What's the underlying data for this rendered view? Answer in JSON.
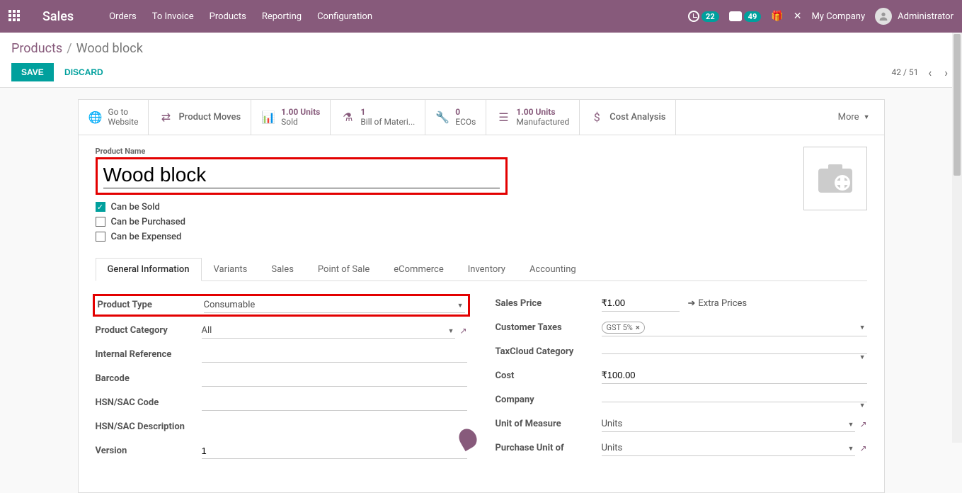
{
  "topbar": {
    "app_title": "Sales",
    "menu": [
      "Orders",
      "To Invoice",
      "Products",
      "Reporting",
      "Configuration"
    ],
    "activity_count": "22",
    "message_count": "49",
    "company": "My Company",
    "user": "Administrator"
  },
  "breadcrumb": {
    "parent": "Products",
    "current": "Wood block"
  },
  "actions": {
    "save": "SAVE",
    "discard": "DISCARD"
  },
  "pager": {
    "text": "42 / 51"
  },
  "stat_buttons": {
    "website": "Go to\nWebsite",
    "moves": "Product Moves",
    "sold_value": "1.00 Units",
    "sold_label": "Sold",
    "bom_value": "1",
    "bom_label": "Bill of Materi...",
    "eco_value": "0",
    "eco_label": "ECOs",
    "mfg_value": "1.00 Units",
    "mfg_label": "Manufactured",
    "cost": "Cost Analysis",
    "more": "More"
  },
  "product": {
    "name_label": "Product Name",
    "name": "Wood block",
    "can_be_sold_label": "Can be Sold",
    "can_be_purchased_label": "Can be Purchased",
    "can_be_expensed_label": "Can be Expensed"
  },
  "tabs": [
    "General Information",
    "Variants",
    "Sales",
    "Point of Sale",
    "eCommerce",
    "Inventory",
    "Accounting"
  ],
  "fields_left": {
    "product_type_label": "Product Type",
    "product_type_value": "Consumable",
    "category_label": "Product Category",
    "category_value": "All",
    "internal_ref_label": "Internal Reference",
    "barcode_label": "Barcode",
    "hsn_code_label": "HSN/SAC Code",
    "hsn_desc_label": "HSN/SAC Description",
    "version_label": "Version",
    "version_value": "1"
  },
  "fields_right": {
    "sales_price_label": "Sales Price",
    "sales_price_value": "₹1.00",
    "extra_prices": "Extra Prices",
    "customer_taxes_label": "Customer Taxes",
    "customer_taxes_tag": "GST 5%",
    "taxcloud_label": "TaxCloud Category",
    "cost_label": "Cost",
    "cost_value": "₹100.00",
    "company_label": "Company",
    "uom_label": "Unit of Measure",
    "uom_value": "Units",
    "purchase_uom_label": "Purchase Unit of",
    "purchase_uom_value": "Units"
  }
}
